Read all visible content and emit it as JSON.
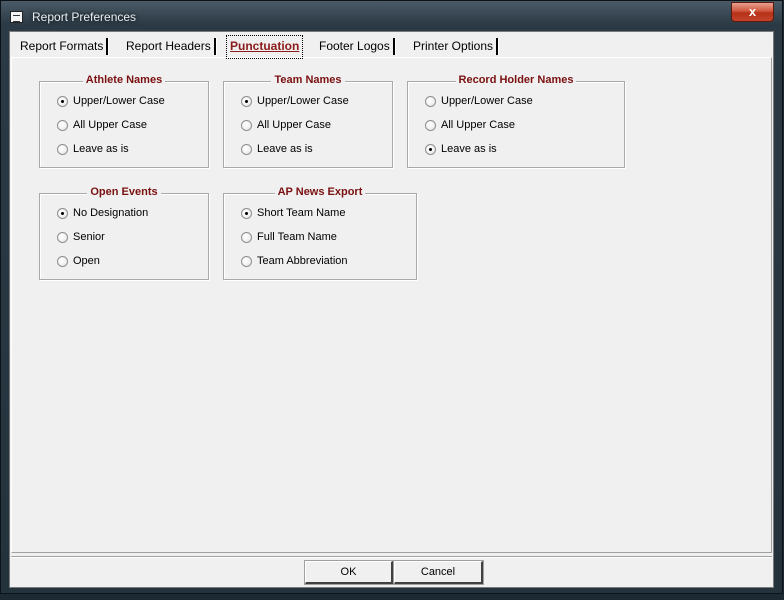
{
  "window": {
    "title": "Report Preferences",
    "close_label": "x"
  },
  "tabs": [
    {
      "label": "Report Formats"
    },
    {
      "label": "Report Headers"
    },
    {
      "label": "Punctuation"
    },
    {
      "label": "Footer Logos"
    },
    {
      "label": "Printer Options"
    }
  ],
  "active_tab": "Punctuation",
  "groups": {
    "athlete": {
      "title": "Athlete Names",
      "options": [
        "Upper/Lower Case",
        "All Upper Case",
        "Leave as is"
      ],
      "selected": 0
    },
    "team": {
      "title": "Team Names",
      "options": [
        "Upper/Lower Case",
        "All Upper Case",
        "Leave as is"
      ],
      "selected": 0
    },
    "record": {
      "title": "Record Holder Names",
      "options": [
        "Upper/Lower Case",
        "All Upper Case",
        "Leave as is"
      ],
      "selected": 2
    },
    "open": {
      "title": "Open Events",
      "options": [
        "No Designation",
        "Senior",
        "Open"
      ],
      "selected": 0
    },
    "ap": {
      "title": "AP News Export",
      "options": [
        "Short Team Name",
        "Full Team Name",
        "Team Abbreviation"
      ],
      "selected": 0
    }
  },
  "buttons": {
    "ok": "OK",
    "cancel": "Cancel"
  },
  "colors": {
    "group_title": "#7a1010",
    "active_tab": "#8b1a1a",
    "close_button": "#c4452c"
  }
}
